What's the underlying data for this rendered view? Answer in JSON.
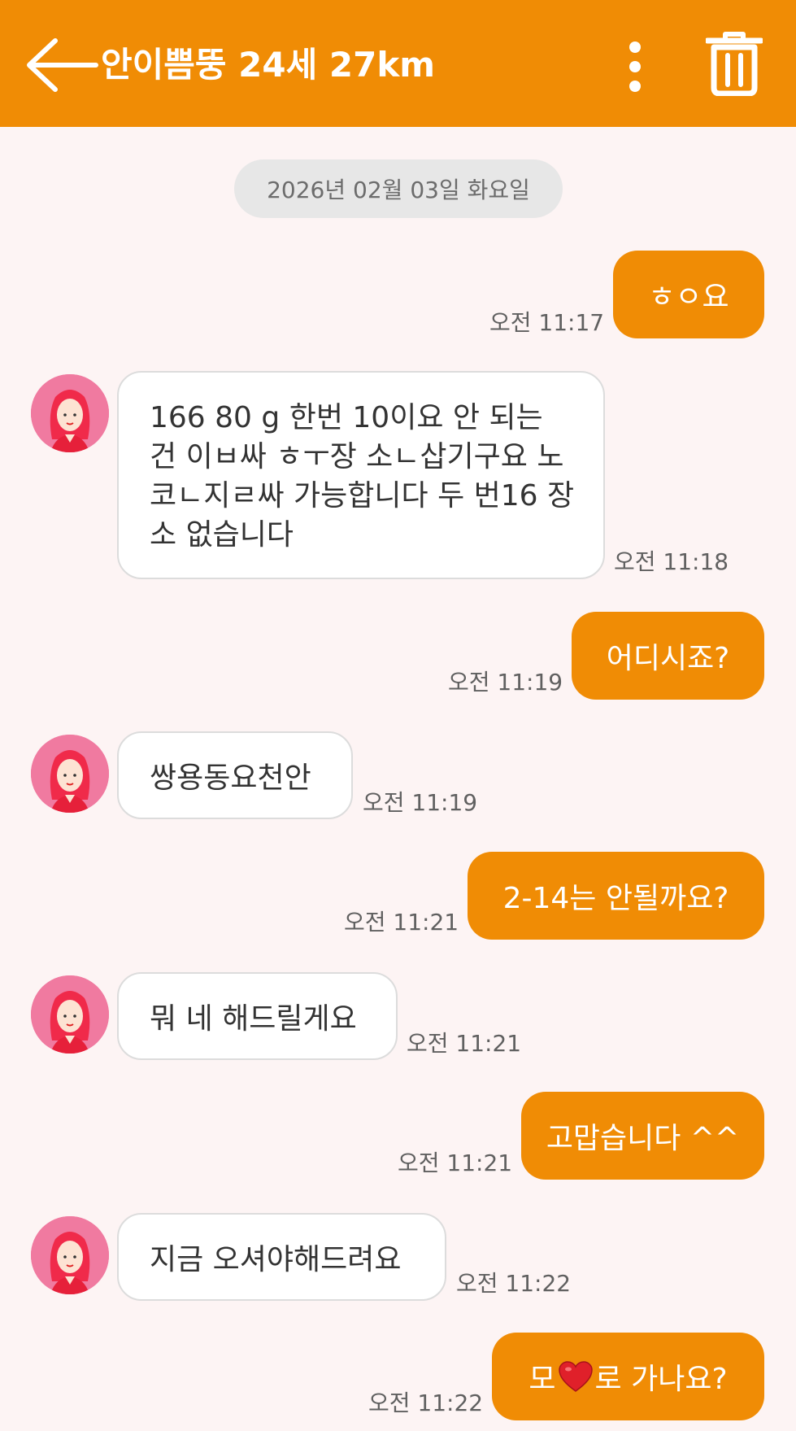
{
  "header": {
    "title": "안이쁨뚱 24세 27km",
    "back_icon": "arrow-left-icon",
    "more_icon": "more-vertical-icon",
    "trash_icon": "trash-icon"
  },
  "date_separator": "2026년 02월 03일 화요일",
  "colors": {
    "accent": "#f08c05",
    "background": "#fdf4f4",
    "received_bubble": "#ffffff",
    "avatar": "#f07aa0",
    "heart": "#e0202a"
  },
  "messages": [
    {
      "direction": "sent",
      "text": "ㅎㅇ요",
      "time": "오전 11:17"
    },
    {
      "direction": "received",
      "text": "166 80 g 한번 10이요 안 되는 건 이ㅂ싸 ㅎㅜ장 소ㄴ삽기구요 노코ㄴ지ㄹ싸 가능합니다 두 번16 장소 없습니다",
      "time": "오전 11:18"
    },
    {
      "direction": "sent",
      "text": "어디시죠?",
      "time": "오전 11:19"
    },
    {
      "direction": "received",
      "text": "쌍용동요천안",
      "time": "오전 11:19"
    },
    {
      "direction": "sent",
      "text": "2-14는 안될까요?",
      "time": "오전 11:21"
    },
    {
      "direction": "received",
      "text": "뭐 네 해드릴게요",
      "time": "오전 11:21"
    },
    {
      "direction": "sent",
      "text": "고맙습니다 ^^",
      "time": "오전 11:21"
    },
    {
      "direction": "received",
      "text": "지금 오셔야해드려요",
      "time": "오전 11:22"
    },
    {
      "direction": "sent",
      "text_before": "모",
      "inline_icon": "heart-icon",
      "text_after": "로 가나요?",
      "time": "오전 11:22"
    }
  ]
}
